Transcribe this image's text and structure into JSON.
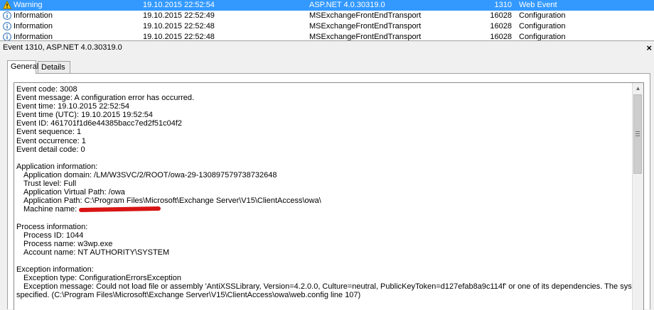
{
  "event_list": {
    "rows": [
      {
        "level": "Warning",
        "date": "19.10.2015 22:52:54",
        "source": "ASP.NET 4.0.30319.0",
        "event_id": "1310",
        "task": "Web Event",
        "selected": true,
        "icon": "warning-icon"
      },
      {
        "level": "Information",
        "date": "19.10.2015 22:52:49",
        "source": "MSExchangeFrontEndTransport",
        "event_id": "16028",
        "task": "Configuration",
        "selected": false,
        "icon": "info-icon"
      },
      {
        "level": "Information",
        "date": "19.10.2015 22:52:48",
        "source": "MSExchangeFrontEndTransport",
        "event_id": "16028",
        "task": "Configuration",
        "selected": false,
        "icon": "info-icon"
      },
      {
        "level": "Information",
        "date": "19.10.2015 22:52:48",
        "source": "MSExchangeFrontEndTransport",
        "event_id": "16028",
        "task": "Configuration",
        "selected": false,
        "icon": "info-icon"
      }
    ]
  },
  "event_header": {
    "title": "Event 1310, ASP.NET 4.0.30319.0",
    "close_glyph": "×"
  },
  "tabs": [
    {
      "label": "General",
      "active": true
    },
    {
      "label": "Details",
      "active": false
    }
  ],
  "details": {
    "event_code": "Event code: 3008",
    "event_message": "Event message: A configuration error has occurred.",
    "event_time": "Event time: 19.10.2015 22:52:54",
    "event_time_utc": "Event time (UTC): 19.10.2015 19:52:54",
    "event_id": "Event ID: 461701f1d6e44385bacc7ed2f51c04f2",
    "event_sequence": "Event sequence: 1",
    "event_occurrence": "Event occurrence: 1",
    "event_detail_code": "Event detail code: 0",
    "application_information": "Application information:",
    "application_domain": "Application domain: /LM/W3SVC/2/ROOT/owa-29-130897579738732648",
    "trust_level": "Trust level: Full",
    "application_virtual_path": "Application Virtual Path: /owa",
    "application_path": "Application Path: C:\\Program Files\\Microsoft\\Exchange Server\\V15\\ClientAccess\\owa\\",
    "machine_name": "Machine name:",
    "process_information": "Process information:",
    "process_id": "Process ID: 1044",
    "process_name": "Process name: w3wp.exe",
    "account_name": "Account name: NT AUTHORITY\\SYSTEM",
    "exception_information": "Exception information:",
    "exception_type": "Exception type: ConfigurationErrorsException",
    "exception_message": "Exception message: Could not load file or assembly 'AntiXSSLibrary, Version=4.2.0.0, Culture=neutral, PublicKeyToken=d127efab8a9c114f' or one of its dependencies. The system cannot find the file",
    "exception_message_cont": "specified. (C:\\Program Files\\Microsoft\\Exchange Server\\V15\\ClientAccess\\owa\\web.config line 107)"
  },
  "colors": {
    "selection": "#3399ff",
    "redaction": "#d81414",
    "warning": "#f5c400",
    "info": "#2a6ebb"
  }
}
